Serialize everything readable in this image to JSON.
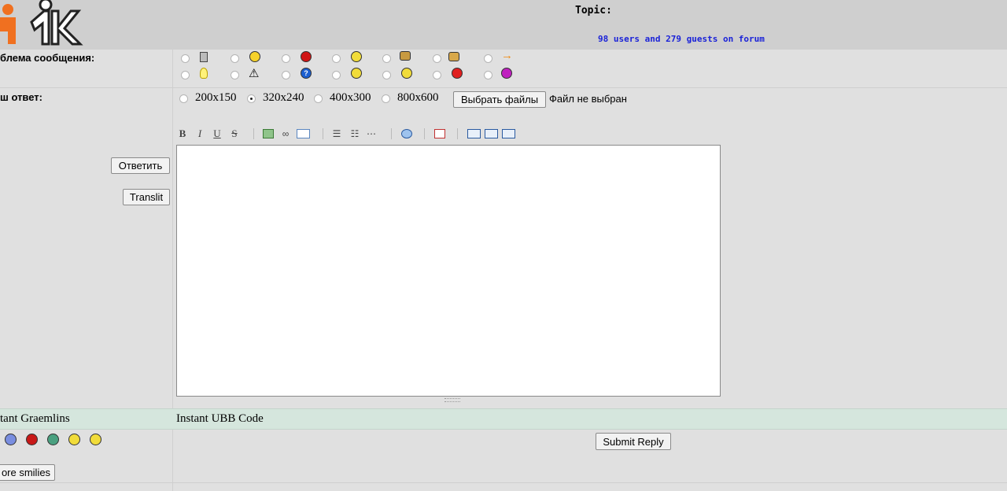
{
  "header": {
    "topic_label": "Topic:",
    "online_text": "98 users and 279 guests on forum"
  },
  "form": {
    "icon_label": "блема сообщения:",
    "reply_label": "ш ответ:",
    "icons_row1": [
      "calculator-icon",
      "grin-smiley-icon",
      "red-circle-icon",
      "smile-smiley-icon",
      "thumbs-down-icon",
      "thumbs-up-icon",
      "arrow-right-icon"
    ],
    "icons_row2": [
      "lightbulb-icon",
      "warning-icon",
      "question-icon",
      "cool-smiley-icon",
      "smiley-icon",
      "angry-smiley-icon",
      "purple-smiley-icon"
    ],
    "sizes": [
      "200x150",
      "320x240",
      "400x300",
      "800x600"
    ],
    "selected_size": "320x240",
    "choose_files_label": "Выбрать файлы",
    "no_file_text": "Файл не выбран",
    "toolbar_bold": "B",
    "toolbar_italic": "I",
    "toolbar_underline": "U",
    "toolbar_strike": "S",
    "reply_button": "Ответить",
    "translit_button": "Translit",
    "message_value": ""
  },
  "bottom": {
    "graemlins_label": "tant Graemlins",
    "ubb_label": "Instant UBB Code",
    "submit_label": "Submit Reply",
    "more_smilies_label": "ore smilies",
    "smilies": [
      "sad-blue-smiley-icon",
      "red-circle-smiley-icon",
      "green-grin-smiley-icon",
      "wink-smiley-icon",
      "neutral-smiley-icon"
    ]
  },
  "colors": {
    "header_bg": "#cfcfcf",
    "page_bg": "#e0e0e0",
    "online_text": "#1a22d8",
    "band_bg": "#d5e6dd",
    "logo_orange": "#f07020"
  }
}
